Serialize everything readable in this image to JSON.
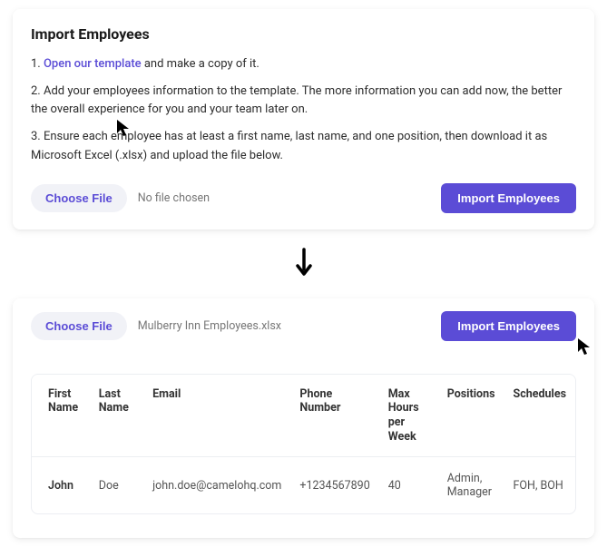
{
  "panel1": {
    "title": "Import Employees",
    "step1_prefix": "1. ",
    "step1_link": "Open our template",
    "step1_suffix": " and make a copy of it.",
    "step2": "2. Add your employees information to the template. The more information you can add now, the better the overall experience for you and your team later on.",
    "step3": "3. Ensure each employee has at least a first name, last name, and one position, then download it as Microsoft Excel (.xlsx) and upload the file below.",
    "choose_file": "Choose File",
    "no_file": "No file chosen",
    "import_btn": "Import Employees"
  },
  "panel2": {
    "choose_file": "Choose File",
    "file_name": "Mulberry Inn Employees.xlsx",
    "import_btn": "Import Employees",
    "headers": {
      "first": "First Name",
      "last": "Last Name",
      "email": "Email",
      "phone": "Phone Number",
      "max": "Max Hours per Week",
      "positions": "Positions",
      "schedules": "Schedules"
    },
    "row": {
      "first": "John",
      "last": "Doe",
      "email": "john.doe@camelohq.com",
      "phone": "+1234567890",
      "max": "40",
      "positions": "Admin, Manager",
      "schedules": "FOH, BOH"
    }
  }
}
